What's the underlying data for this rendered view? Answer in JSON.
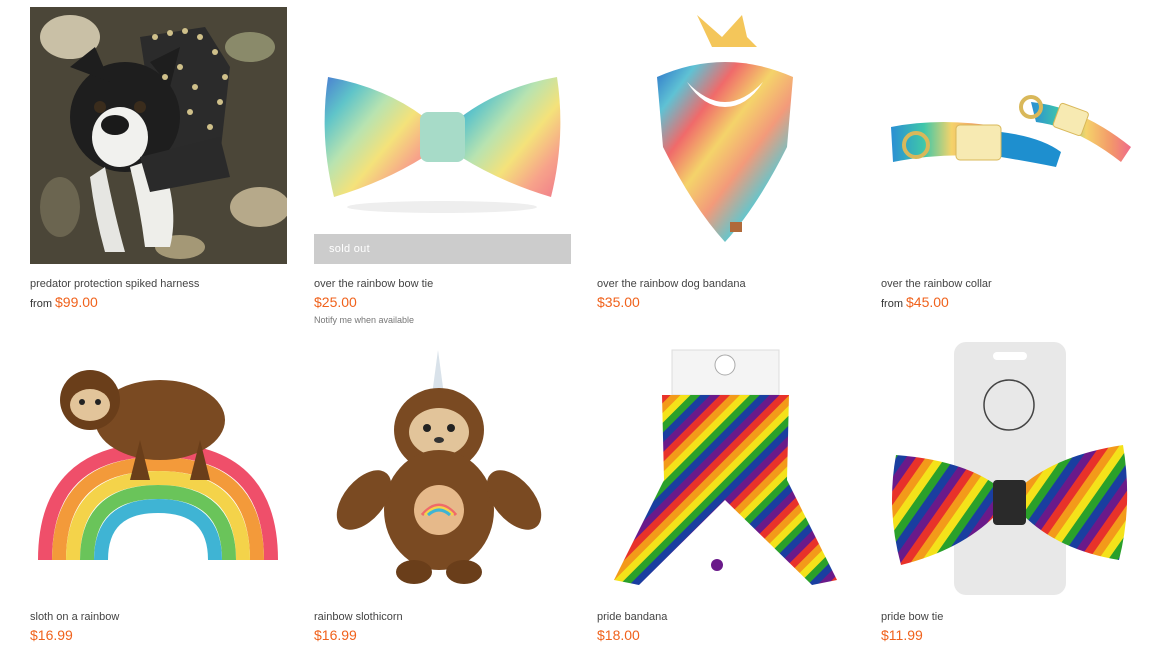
{
  "colors": {
    "price": "#f0621c",
    "soldout_bg": "#cccccc",
    "text": "#444444"
  },
  "products": [
    {
      "title": "predator protection spiked harness",
      "from_label": "from",
      "price": "$99.00",
      "image": "spiked-harness-dog-photo"
    },
    {
      "title": "over the rainbow bow tie",
      "price": "$25.00",
      "badge": "sold out",
      "notify": "Notify me when available",
      "image": "rainbow-bow-tie"
    },
    {
      "title": "over the rainbow dog bandana",
      "price": "$35.00",
      "image": "rainbow-bandana"
    },
    {
      "title": "over the rainbow collar",
      "from_label": "from",
      "price": "$45.00",
      "image": "rainbow-collar"
    },
    {
      "title": "sloth on a rainbow",
      "price": "$16.99",
      "image": "sloth-rainbow-toy"
    },
    {
      "title": "rainbow slothicorn",
      "price": "$16.99",
      "image": "slothicorn-toy"
    },
    {
      "title": "pride bandana",
      "price": "$18.00",
      "image": "pride-bandana"
    },
    {
      "title": "pride bow tie",
      "price": "$11.99",
      "image": "pride-bow-tie"
    }
  ]
}
